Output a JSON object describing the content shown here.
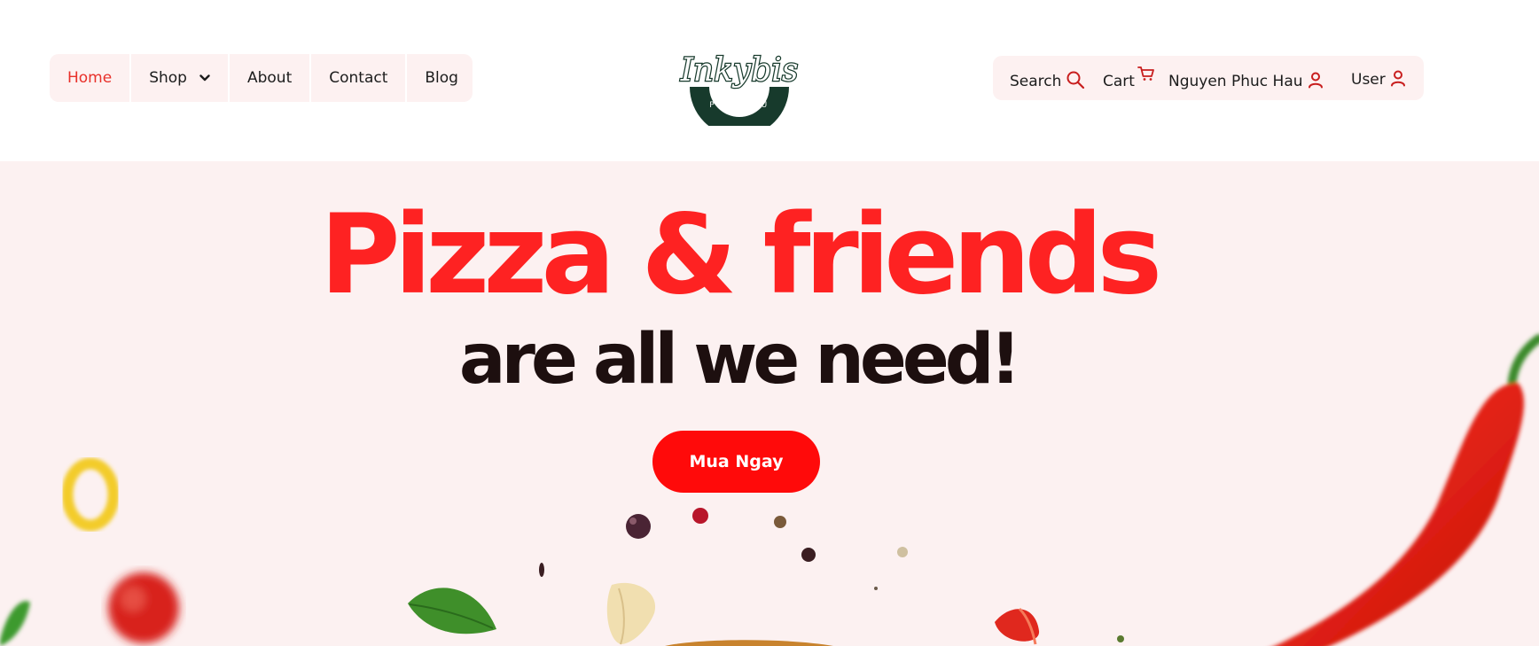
{
  "nav": {
    "items": [
      {
        "label": "Home",
        "active": true
      },
      {
        "label": "Shop",
        "dropdown": true
      },
      {
        "label": "About"
      },
      {
        "label": "Contact"
      },
      {
        "label": "Blog"
      }
    ]
  },
  "logo": {
    "script_text": "Inkybis",
    "sub_text": "PHUC HAU"
  },
  "utility": {
    "search_label": "Search",
    "cart_label": "Cart",
    "account_name": "Nguyen Phuc Hau",
    "user_label": "User"
  },
  "hero": {
    "title": "Pizza & friends",
    "subtitle": "are all we need!",
    "cta_label": "Mua Ngay"
  },
  "icons": {
    "search": "search-icon",
    "cart": "cart-icon",
    "user": "user-icon",
    "chevron": "chevron-down-icon"
  },
  "colors": {
    "accent": "#fe2222",
    "cta": "#ff0a0a",
    "hero_bg": "#fcf1f1",
    "nav_bg": "#fdf1f1",
    "dark_text": "#1d0f0f",
    "icon_red": "#c81e1e"
  }
}
